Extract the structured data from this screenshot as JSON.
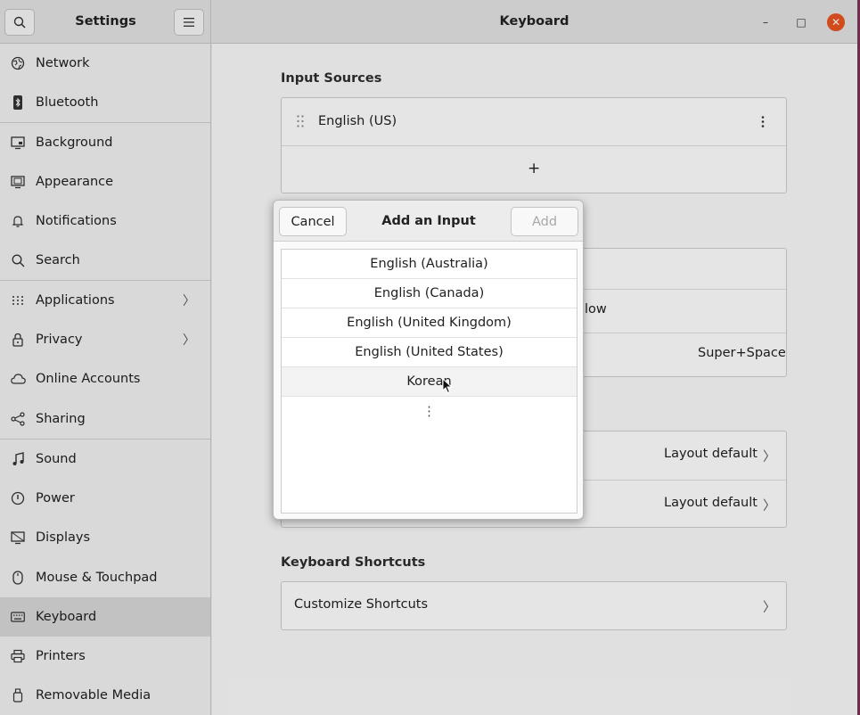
{
  "sidebar": {
    "title": "Settings",
    "items": [
      {
        "label": "Network",
        "icon": "network-icon"
      },
      {
        "label": "Bluetooth",
        "icon": "bluetooth-icon"
      },
      {
        "label": "Background",
        "icon": "background-icon"
      },
      {
        "label": "Appearance",
        "icon": "appearance-icon"
      },
      {
        "label": "Notifications",
        "icon": "bell-icon"
      },
      {
        "label": "Search",
        "icon": "search-icon"
      },
      {
        "label": "Applications",
        "icon": "apps-grid-icon",
        "chevron": "〉"
      },
      {
        "label": "Privacy",
        "icon": "lock-icon",
        "chevron": "〉"
      },
      {
        "label": "Online Accounts",
        "icon": "cloud-icon"
      },
      {
        "label": "Sharing",
        "icon": "share-icon"
      },
      {
        "label": "Sound",
        "icon": "music-note-icon"
      },
      {
        "label": "Power",
        "icon": "power-icon"
      },
      {
        "label": "Displays",
        "icon": "display-icon"
      },
      {
        "label": "Mouse & Touchpad",
        "icon": "mouse-icon"
      },
      {
        "label": "Keyboard",
        "icon": "keyboard-icon",
        "active": true
      },
      {
        "label": "Printers",
        "icon": "printer-icon"
      },
      {
        "label": "Removable Media",
        "icon": "removable-media-icon"
      }
    ]
  },
  "header": {
    "title": "Keyboard",
    "minimize": "–",
    "maximize": "□",
    "close": "✕"
  },
  "input_sources": {
    "title": "Input Sources",
    "items": [
      "English (US)"
    ],
    "add": "+"
  },
  "switching": {
    "row2_partial": "low",
    "row3_shortcut": "Super+Space"
  },
  "special_keys": {
    "row1_value": "Layout default",
    "row2_value": "Layout default",
    "chevron": "〉"
  },
  "shortcuts": {
    "title": "Keyboard Shortcuts",
    "customize": "Customize Shortcuts",
    "chevron": "〉"
  },
  "dialog": {
    "cancel": "Cancel",
    "title": "Add an Input Source",
    "add": "Add",
    "languages": [
      "English (Australia)",
      "English (Canada)",
      "English (United Kingdom)",
      "English (United States)",
      "Korean"
    ],
    "more": "⋮",
    "hovered_index": 4
  },
  "colors": {
    "accent": "#e95420",
    "sidebar_active": "#d9d9d9"
  }
}
